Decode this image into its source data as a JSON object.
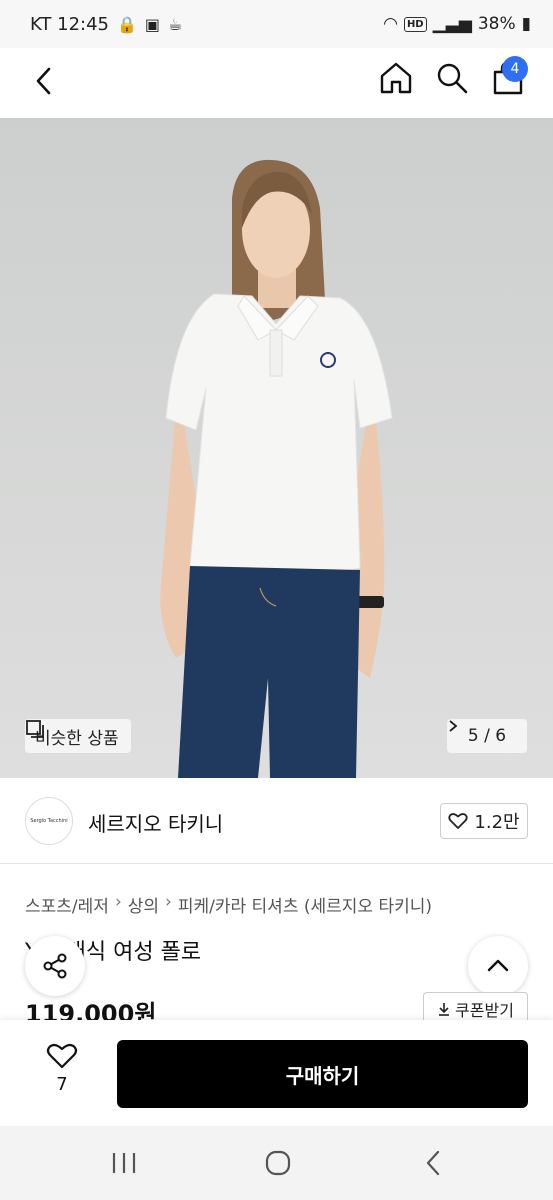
{
  "status_bar": {
    "carrier_time": "KT 12:45",
    "battery": "38%",
    "hd_label": "HD"
  },
  "top_nav": {
    "cart_count": "4"
  },
  "hero": {
    "similar_label": "비슷한 상품",
    "pager": "5 / 6"
  },
  "brand": {
    "logo_text": "Sergio Tacchini",
    "name": "세르지오 타키니",
    "likes": "1.2만"
  },
  "breadcrumb": [
    "스포츠/레저",
    "상의",
    "피케/카라 티셔츠 (세르지오 타키니)"
  ],
  "product": {
    "title_visible": "Y 클래식 여성 폴로",
    "price": "119,000원",
    "coupon_label": "쿠폰받기"
  },
  "bottom_bar": {
    "wish_count": "7",
    "buy_label": "구매하기"
  },
  "colors": {
    "accent_blue": "#2f6ff2",
    "buy_button": "#000000"
  }
}
